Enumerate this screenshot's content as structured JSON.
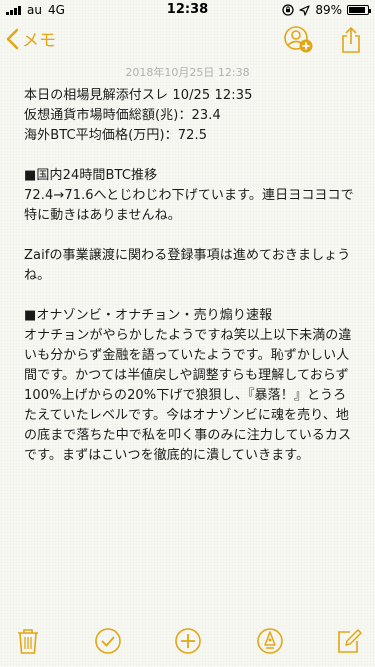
{
  "status": {
    "carrier": "au",
    "network": "4G",
    "time": "12:38",
    "battery_percent": "89%",
    "battery_level": 0.89
  },
  "nav": {
    "back_label": "メモ"
  },
  "note": {
    "date": "2018年10月25日 12:38",
    "lines": [
      "本日の相場見解添付スレ 10/25 12:35",
      "仮想通貨市場時価総額(兆)：23.4",
      "海外BTC平均価格(万円)：72.5",
      "",
      "■国内24時間BTC推移",
      "72.4→71.6へとじわじわ下げています。連日ヨコヨコで特に動きはありませんね。",
      "",
      "Zaifの事業譲渡に関わる登録事項は進めておきましょうね。",
      "",
      "■オナゾンビ・オナチョン・売り煽り速報",
      "オナチョンがやらかしたようですね笑以上以下未満の違いも分からず金融を語っていたようです。恥ずかしい人間です。かつては半値戻しや調整すらも理解しておらず100%上げからの20%下げで狼狽し、『暴落！』とうろたえていたレベルです。今はオナゾンビに魂を売り、地の底まで落ちた中で私を叩く事のみに注力しているカスです。まずはこいつを徹底的に潰していきます。"
    ]
  },
  "colors": {
    "accent": "#e2a617",
    "background": "#f8f8f3",
    "text": "#1a1a1a",
    "date_text": "#b0b0b0"
  },
  "icons": {
    "back": "chevron-left-icon",
    "add_person": "add-person-icon",
    "share": "share-icon",
    "trash": "trash-icon",
    "checklist": "checkmark-circle-icon",
    "add": "plus-circle-icon",
    "sketch": "pen-tip-icon",
    "compose": "compose-icon"
  }
}
